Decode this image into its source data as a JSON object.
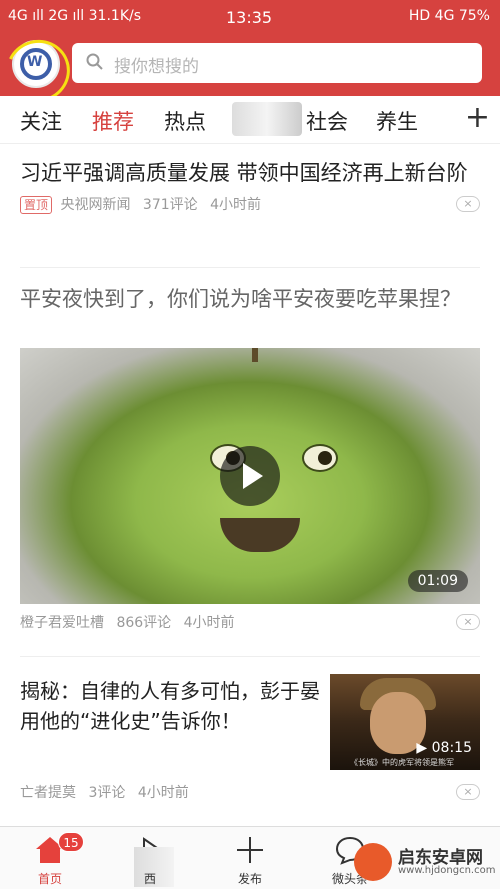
{
  "status_bar": {
    "left": "4G ıll 2G ıll 31.1K/s",
    "time": "13:35",
    "right": "HD 4G 75%"
  },
  "header": {
    "logo_icon": "vw-logo",
    "search_placeholder": "搜你想搜的"
  },
  "tabs": {
    "items": [
      "关注",
      "推荐",
      "热点",
      "社会",
      "养生"
    ],
    "active": "推荐",
    "add_label": "+"
  },
  "feed": [
    {
      "title": "习近平强调高质量发展 带领中国经济再上新台阶",
      "tag": "置顶",
      "source": "央视网新闻",
      "comments": "371评论",
      "time": "4小时前"
    },
    {
      "title": "平安夜快到了，你们说为啥平安夜要吃苹果捏？",
      "duration": "01:09",
      "source": "橙子君爱吐槽",
      "comments": "866评论",
      "time": "4小时前"
    },
    {
      "title": "揭秘：自律的人有多可怕，彭于晏 用他的“进化史”告诉你！",
      "thumb_duration": "08:15",
      "thumb_caption": "《长城》中的虎军将领是熊军",
      "source": "亡者提莫",
      "comments": "3评论",
      "time": "4小时前"
    }
  ],
  "dismiss_label": "×",
  "bottom_nav": [
    {
      "label": "首页",
      "icon": "home-icon",
      "badge": "15"
    },
    {
      "label": "西",
      "icon": "play-icon"
    },
    {
      "label": "发布",
      "icon": "plus-icon"
    },
    {
      "label": "微头条",
      "icon": "chat-icon"
    }
  ],
  "watermark": {
    "title": "启东安卓网",
    "url": "www.hjdongcn.com"
  },
  "colors": {
    "brand_red": "#d6423f",
    "text": "#222222",
    "meta": "#999999"
  }
}
